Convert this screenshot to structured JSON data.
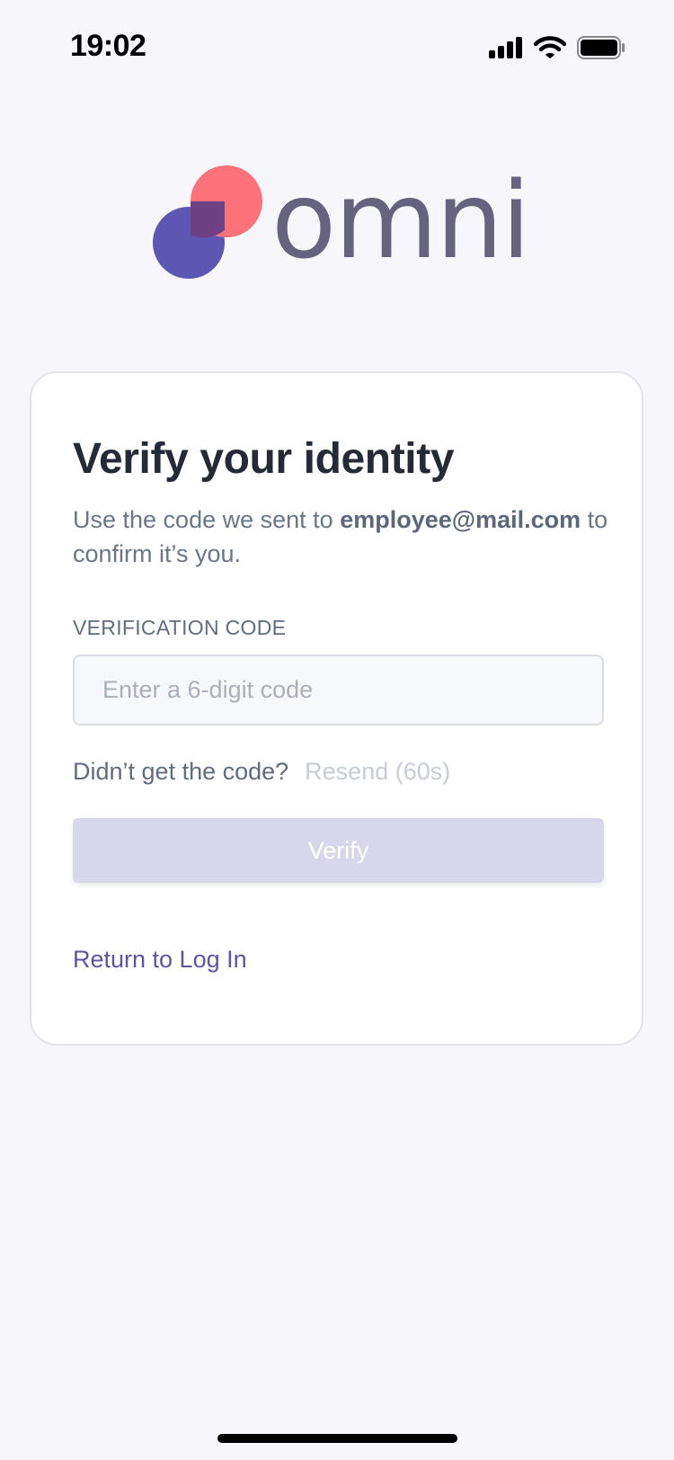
{
  "status_bar": {
    "time": "19:02",
    "icons": [
      "cellular-signal-icon",
      "wifi-icon",
      "battery-icon"
    ]
  },
  "logo": {
    "text": "omni",
    "colors": {
      "coral": "#fd7179",
      "indigo": "#5d57b4",
      "overlap": "#6e4187",
      "wordmark": "#65637d"
    }
  },
  "card": {
    "title": "Verify your identity",
    "subtitle_prefix": "Use the code we sent to",
    "email": "employee@mail.com",
    "subtitle_suffix": "to confirm it’s you.",
    "field_label": "VERIFICATION CODE",
    "code_input": {
      "placeholder": "Enter a 6-digit code",
      "value": ""
    },
    "resend_prompt": "Didn’t get the code?",
    "resend_label": "Resend (60s)",
    "verify_label": "Verify",
    "return_label": "Return to Log In"
  },
  "colors": {
    "background": "#f7f7fb",
    "accent": "#5d55a3",
    "disabled_button": "#d8d6ea",
    "title": "#252b36",
    "body_text": "#68768a"
  }
}
